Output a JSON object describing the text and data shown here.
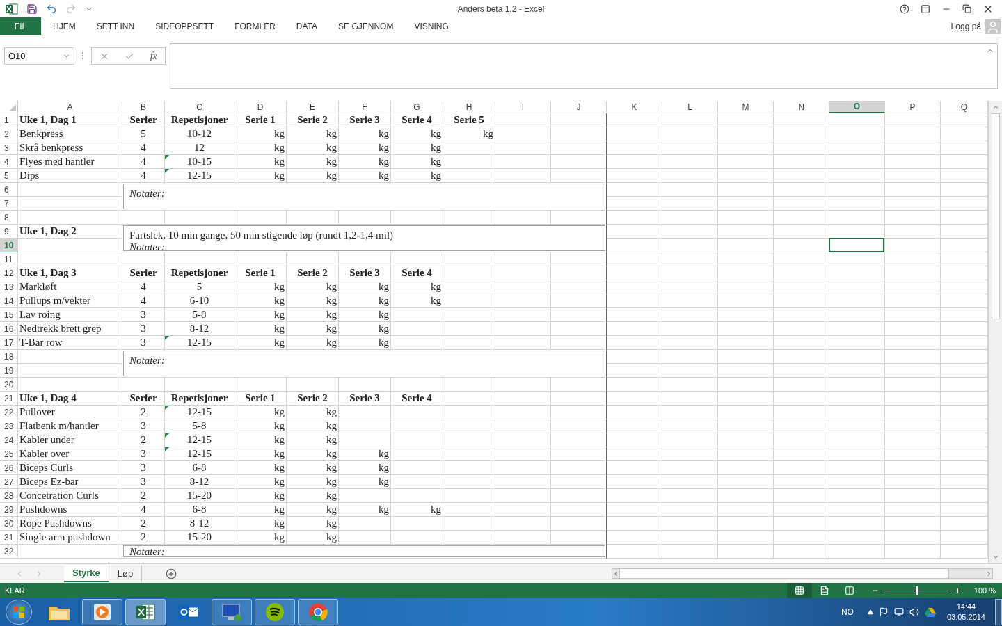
{
  "window": {
    "title": "Anders beta 1.2 - Excel",
    "sign_in": "Logg på"
  },
  "ribbon_tabs": [
    {
      "label": "FIL",
      "kind": "file",
      "selected": false
    },
    {
      "label": "HJEM",
      "kind": "tab",
      "selected": false
    },
    {
      "label": "SETT INN",
      "kind": "tab",
      "selected": false
    },
    {
      "label": "SIDEOPPSETT",
      "kind": "tab",
      "selected": false
    },
    {
      "label": "FORMLER",
      "kind": "tab",
      "selected": false
    },
    {
      "label": "DATA",
      "kind": "tab",
      "selected": false
    },
    {
      "label": "SE GJENNOM",
      "kind": "tab",
      "selected": false
    },
    {
      "label": "VISNING",
      "kind": "tab",
      "selected": false
    }
  ],
  "formula_bar": {
    "name_box": "O10",
    "fx_label": "fx"
  },
  "columns": [
    {
      "label": "A",
      "selected": false
    },
    {
      "label": "B",
      "selected": false
    },
    {
      "label": "C",
      "selected": false
    },
    {
      "label": "D",
      "selected": false
    },
    {
      "label": "E",
      "selected": false
    },
    {
      "label": "F",
      "selected": false
    },
    {
      "label": "G",
      "selected": false
    },
    {
      "label": "H",
      "selected": false
    },
    {
      "label": "I",
      "selected": false
    },
    {
      "label": "J",
      "selected": false
    },
    {
      "label": "K",
      "selected": false
    },
    {
      "label": "L",
      "selected": false
    },
    {
      "label": "M",
      "selected": false
    },
    {
      "label": "N",
      "selected": false
    },
    {
      "label": "O",
      "selected": true
    },
    {
      "label": "P",
      "selected": false
    },
    {
      "label": "Q",
      "selected": false
    }
  ],
  "rows": [
    {
      "kind": "header",
      "number": "1",
      "selected": false,
      "label": "Uke 1, Dag 1",
      "headings": [
        "Serier",
        "Repetisjoner",
        "Serie 1",
        "Serie 2",
        "Serie 3",
        "Serie 4",
        "Serie 5"
      ]
    },
    {
      "kind": "exercise",
      "number": "2",
      "selected": false,
      "name": "Benkpress",
      "sets": "5",
      "reps": "10-12",
      "flagged": false,
      "weights": [
        "kg",
        "kg",
        "kg",
        "kg",
        "kg"
      ]
    },
    {
      "kind": "exercise",
      "number": "3",
      "selected": false,
      "name": "Skrå benkpress",
      "sets": "4",
      "reps": "12",
      "flagged": false,
      "weights": [
        "kg",
        "kg",
        "kg",
        "kg"
      ]
    },
    {
      "kind": "exercise",
      "number": "4",
      "selected": false,
      "name": "Flyes med hantler",
      "sets": "4",
      "reps": "10-15",
      "flagged": true,
      "weights": [
        "kg",
        "kg",
        "kg",
        "kg"
      ]
    },
    {
      "kind": "exercise",
      "number": "5",
      "selected": false,
      "name": "Dips",
      "sets": "4",
      "reps": "12-15",
      "flagged": true,
      "weights": [
        "kg",
        "kg",
        "kg",
        "kg"
      ]
    },
    {
      "kind": "note",
      "rows": [
        {
          "number": "6",
          "selected": false
        },
        {
          "number": "7",
          "selected": false
        }
      ],
      "lines": [
        {
          "text": "Notater:",
          "italic": true
        }
      ]
    },
    {
      "kind": "blank",
      "number": "8",
      "selected": false
    },
    {
      "kind": "note",
      "rows": [
        {
          "number": "9",
          "selected": false,
          "label": "Uke 1, Dag 2"
        },
        {
          "number": "10",
          "selected": true
        }
      ],
      "lines": [
        {
          "text": "Fartslek, 10 min gange, 50 min stigende løp (rundt 1,2-1,4 mil)",
          "italic": false
        },
        {
          "text": "Notater:",
          "italic": true
        }
      ]
    },
    {
      "kind": "blank",
      "number": "11",
      "selected": false
    },
    {
      "kind": "header",
      "number": "12",
      "selected": false,
      "label": "Uke 1, Dag 3",
      "headings": [
        "Serier",
        "Repetisjoner",
        "Serie 1",
        "Serie 2",
        "Serie 3",
        "Serie 4"
      ]
    },
    {
      "kind": "exercise",
      "number": "13",
      "selected": false,
      "name": "Markløft",
      "sets": "4",
      "reps": "5",
      "flagged": false,
      "weights": [
        "kg",
        "kg",
        "kg",
        "kg"
      ]
    },
    {
      "kind": "exercise",
      "number": "14",
      "selected": false,
      "name": "Pullups m/vekter",
      "sets": "4",
      "reps": "6-10",
      "flagged": false,
      "weights": [
        "kg",
        "kg",
        "kg",
        "kg"
      ]
    },
    {
      "kind": "exercise",
      "number": "15",
      "selected": false,
      "name": "Lav roing",
      "sets": "3",
      "reps": "5-8",
      "flagged": false,
      "weights": [
        "kg",
        "kg",
        "kg"
      ]
    },
    {
      "kind": "exercise",
      "number": "16",
      "selected": false,
      "name": "Nedtrekk brett grep",
      "sets": "3",
      "reps": "8-12",
      "flagged": false,
      "weights": [
        "kg",
        "kg",
        "kg"
      ]
    },
    {
      "kind": "exercise",
      "number": "17",
      "selected": false,
      "name": "T-Bar row",
      "sets": "3",
      "reps": "12-15",
      "flagged": true,
      "weights": [
        "kg",
        "kg",
        "kg"
      ]
    },
    {
      "kind": "note",
      "rows": [
        {
          "number": "18",
          "selected": false
        },
        {
          "number": "19",
          "selected": false
        }
      ],
      "lines": [
        {
          "text": "Notater:",
          "italic": true
        }
      ]
    },
    {
      "kind": "blank",
      "number": "20",
      "selected": false
    },
    {
      "kind": "header",
      "number": "21",
      "selected": false,
      "label": "Uke 1, Dag 4",
      "headings": [
        "Serier",
        "Repetisjoner",
        "Serie 1",
        "Serie 2",
        "Serie 3",
        "Serie 4"
      ]
    },
    {
      "kind": "exercise",
      "number": "22",
      "selected": false,
      "name": "Pullover",
      "sets": "2",
      "reps": "12-15",
      "flagged": true,
      "weights": [
        "kg",
        "kg"
      ]
    },
    {
      "kind": "exercise",
      "number": "23",
      "selected": false,
      "name": "Flatbenk m/hantler",
      "sets": "3",
      "reps": "5-8",
      "flagged": false,
      "weights": [
        "kg",
        "kg"
      ]
    },
    {
      "kind": "exercise",
      "number": "24",
      "selected": false,
      "name": "Kabler under",
      "sets": "2",
      "reps": "12-15",
      "flagged": true,
      "weights": [
        "kg",
        "kg"
      ]
    },
    {
      "kind": "exercise",
      "number": "25",
      "selected": false,
      "name": "Kabler over",
      "sets": "3",
      "reps": "12-15",
      "flagged": true,
      "weights": [
        "kg",
        "kg",
        "kg"
      ]
    },
    {
      "kind": "exercise",
      "number": "26",
      "selected": false,
      "name": "Biceps Curls",
      "sets": "3",
      "reps": "6-8",
      "flagged": false,
      "weights": [
        "kg",
        "kg",
        "kg"
      ]
    },
    {
      "kind": "exercise",
      "number": "27",
      "selected": false,
      "name": "Biceps Ez-bar",
      "sets": "3",
      "reps": "8-12",
      "flagged": false,
      "weights": [
        "kg",
        "kg",
        "kg"
      ]
    },
    {
      "kind": "exercise",
      "number": "28",
      "selected": false,
      "name": "Concetration Curls",
      "sets": "2",
      "reps": "15-20",
      "flagged": false,
      "weights": [
        "kg",
        "kg"
      ]
    },
    {
      "kind": "exercise",
      "number": "29",
      "selected": false,
      "name": "Pushdowns",
      "sets": "4",
      "reps": "6-8",
      "flagged": false,
      "weights": [
        "kg",
        "kg",
        "kg",
        "kg"
      ]
    },
    {
      "kind": "exercise",
      "number": "30",
      "selected": false,
      "name": "Rope Pushdowns",
      "sets": "2",
      "reps": "8-12",
      "flagged": false,
      "weights": [
        "kg",
        "kg"
      ]
    },
    {
      "kind": "exercise",
      "number": "31",
      "selected": false,
      "name": "Single arm pushdown",
      "sets": "2",
      "reps": "15-20",
      "flagged": false,
      "weights": [
        "kg",
        "kg"
      ]
    },
    {
      "kind": "note",
      "rows": [
        {
          "number": "32",
          "selected": false
        }
      ],
      "lines": [
        {
          "text": "Notater:",
          "italic": true
        }
      ]
    }
  ],
  "sheet_tabs": [
    {
      "label": "Styrke",
      "selected": true
    },
    {
      "label": "Løp",
      "selected": false
    }
  ],
  "status_bar": {
    "status": "KLAR",
    "views": [
      {
        "kind": "normal",
        "selected": true
      },
      {
        "kind": "page-layout",
        "selected": false
      },
      {
        "kind": "page-break",
        "selected": false
      }
    ],
    "zoom": {
      "level": 0.5,
      "reading": "100 %"
    }
  },
  "taskbar": {
    "apps": [
      {
        "kind": "folder",
        "open": false,
        "selected": false
      },
      {
        "kind": "media",
        "open": true,
        "selected": false
      },
      {
        "kind": "spreadsheet",
        "open": true,
        "selected": true
      },
      {
        "kind": "mail",
        "open": false,
        "selected": false
      },
      {
        "kind": "remote",
        "open": true,
        "selected": false
      },
      {
        "kind": "music",
        "open": true,
        "selected": false
      },
      {
        "kind": "browser",
        "open": true,
        "selected": false
      }
    ],
    "language": "NO",
    "time": "14:44",
    "date": "03.05.2014"
  }
}
